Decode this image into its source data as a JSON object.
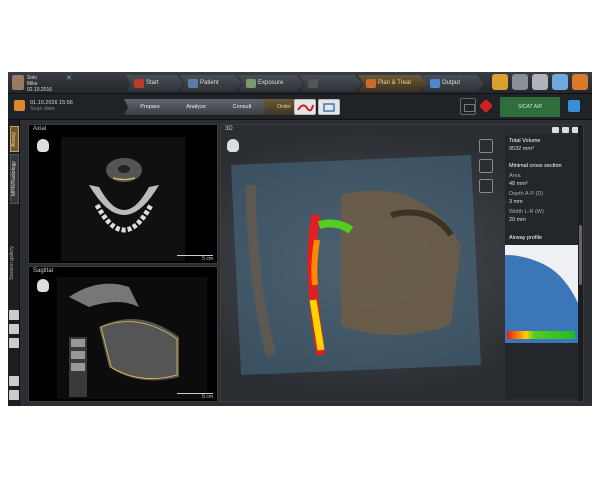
{
  "patient": {
    "name": "Solo",
    "first": "Mike",
    "dob": "02.10.2016"
  },
  "workflow_tabs": [
    {
      "label": "Start",
      "icon": "start-icon",
      "color": "#c0392b"
    },
    {
      "label": "Patient",
      "icon": "patient-icon",
      "color": "#5a7ea8"
    },
    {
      "label": "Exposure",
      "icon": "exposure-icon",
      "color": "#7a9a6a"
    },
    {
      "label": "",
      "icon": "diagnosis-icon",
      "color": "#555"
    },
    {
      "label": "Plan & Treat",
      "icon": "plan-treat-icon",
      "color": "#cc6a2a"
    },
    {
      "label": "Output",
      "icon": "output-icon",
      "color": "#4a8ad4"
    }
  ],
  "scan": {
    "date": "01.10.2016 15:56",
    "label": "Scan date"
  },
  "steps": [
    "Prepare",
    "Analyze",
    "Consult",
    "Order"
  ],
  "sicat": "SICAT AIR",
  "side_tabs": [
    "Airway",
    "MPR/Radiology"
  ],
  "session_gallery": "Session gallery",
  "axial": {
    "title": "Axial",
    "scale": "5 cm"
  },
  "sagittal": {
    "title": "Sagittal",
    "scale": "5 cm"
  },
  "view3d": {
    "title": "3D"
  },
  "metrics": {
    "total_volume_label": "Total Volume",
    "total_volume": "9532 mm³",
    "min_section_label": "Minimal cross section",
    "area_label": "Area",
    "area": "48 mm²",
    "depth_label": "Depth A-P (D)",
    "depth": "3 mm",
    "width_label": "Width L-R (W)",
    "width": "20 mm",
    "profile_label": "Airway profile"
  },
  "colors": {
    "accent": "#d0a050",
    "gradient_low": "#e21e1e",
    "gradient_high": "#22bb22"
  }
}
